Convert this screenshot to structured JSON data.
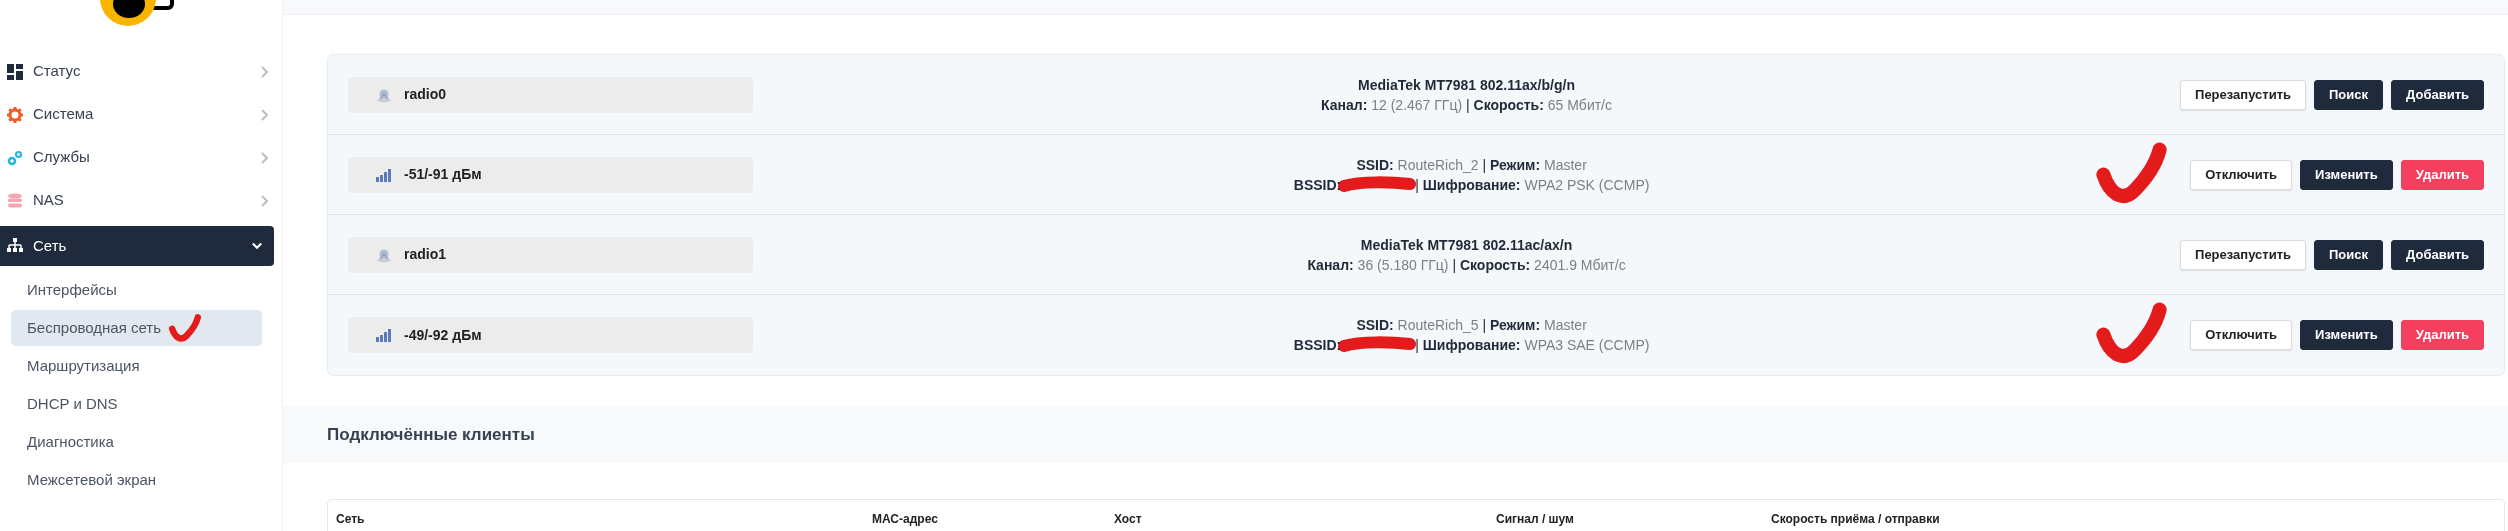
{
  "sidebar": {
    "items": [
      {
        "label": "Статус",
        "selected": false,
        "expanded": false
      },
      {
        "label": "Система",
        "selected": false,
        "expanded": false
      },
      {
        "label": "Службы",
        "selected": false,
        "expanded": false
      },
      {
        "label": "NAS",
        "selected": false,
        "expanded": false
      },
      {
        "label": "Сеть",
        "selected": true,
        "expanded": true,
        "children": [
          {
            "label": "Интерфейсы",
            "selected": false,
            "checkmark": false
          },
          {
            "label": "Беспроводная сеть",
            "selected": true,
            "checkmark": true
          },
          {
            "label": "Маршрутизация",
            "selected": false,
            "checkmark": false
          },
          {
            "label": "DHCP и DNS",
            "selected": false,
            "checkmark": false
          },
          {
            "label": "Диагностика",
            "selected": false,
            "checkmark": false
          },
          {
            "label": "Межсетевой экран",
            "selected": false,
            "checkmark": false
          }
        ]
      }
    ]
  },
  "separator": "|",
  "radios": [
    {
      "kind": "device",
      "name": "radio0",
      "checkmark": false,
      "lines": [
        [
          {
            "label": "MediaTek MT7981 802.11ax/b/g/n"
          }
        ],
        [
          {
            "label": "Канал:",
            "value": "12 (2.467 ГГц)"
          },
          {
            "label": "Скорость:",
            "value": "65 Мбит/с"
          }
        ]
      ],
      "buttons": [
        {
          "label": "Перезапустить"
        },
        {
          "label": "Поиск"
        },
        {
          "label": "Добавить"
        }
      ]
    },
    {
      "kind": "network",
      "name": "-51/-91 дБм",
      "checkmark": true,
      "lines": [
        [
          {
            "label": "SSID:",
            "value": "RouteRich_2"
          },
          {
            "label": "Режим:",
            "value": "Master"
          }
        ],
        [
          {
            "label": "BSSID:",
            "redacted": true
          },
          {
            "label": "Шифрование:",
            "value": "WPA2 PSK (CCMP)"
          }
        ]
      ],
      "buttons": [
        {
          "label": "Отключить"
        },
        {
          "label": "Изменить"
        },
        {
          "label": "Удалить"
        }
      ]
    },
    {
      "kind": "device",
      "name": "radio1",
      "checkmark": false,
      "lines": [
        [
          {
            "label": "MediaTek MT7981 802.11ac/ax/n"
          }
        ],
        [
          {
            "label": "Канал:",
            "value": "36 (5.180 ГГц)"
          },
          {
            "label": "Скорость:",
            "value": "2401.9 Мбит/с"
          }
        ]
      ],
      "buttons": [
        {
          "label": "Перезапустить"
        },
        {
          "label": "Поиск"
        },
        {
          "label": "Добавить"
        }
      ]
    },
    {
      "kind": "network",
      "name": "-49/-92 дБм",
      "checkmark": true,
      "lines": [
        [
          {
            "label": "SSID:",
            "value": "RouteRich_5"
          },
          {
            "label": "Режим:",
            "value": "Master"
          }
        ],
        [
          {
            "label": "BSSID:",
            "redacted": true
          },
          {
            "label": "Шифрование:",
            "value": "WPA3 SAE (CCMP)"
          }
        ]
      ],
      "buttons": [
        {
          "label": "Отключить"
        },
        {
          "label": "Изменить"
        },
        {
          "label": "Удалить"
        }
      ]
    }
  ],
  "clients": {
    "title": "Подключённые клиенты",
    "columns": [
      "Сеть",
      "МАС-адрес",
      "Хост",
      "Сигнал / шум",
      "Скорость приёма / отправки"
    ]
  }
}
